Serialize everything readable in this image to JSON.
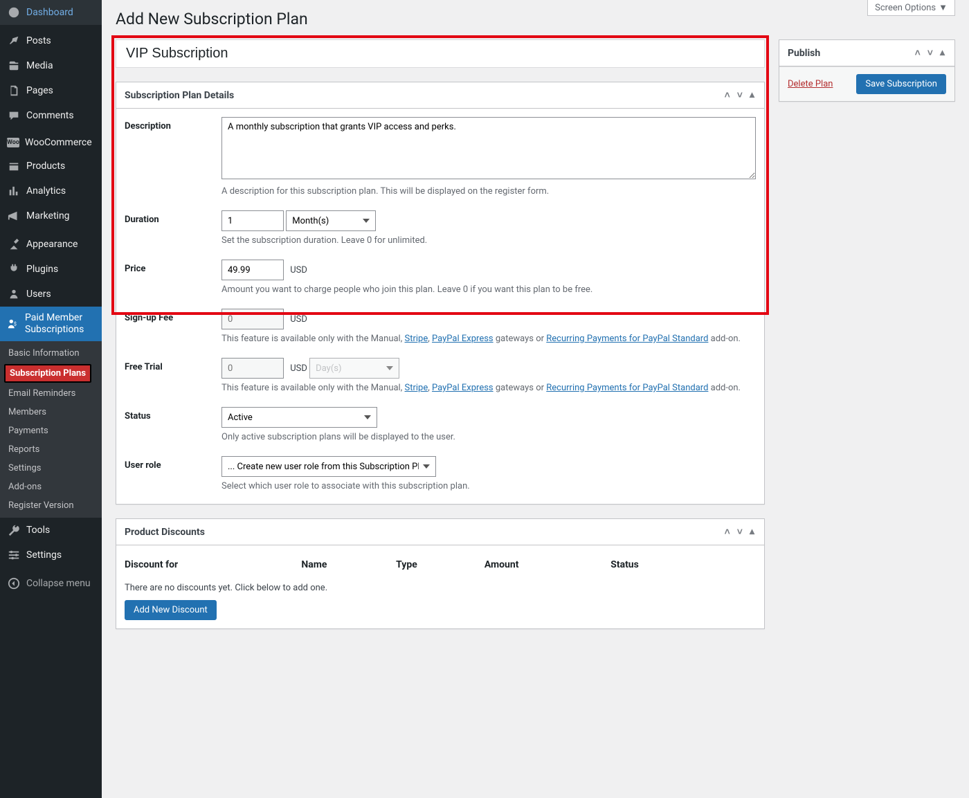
{
  "screen_options_label": "Screen Options",
  "page_title": "Add New Subscription Plan",
  "sidebar": {
    "items": [
      {
        "icon": "dashboard",
        "label": "Dashboard"
      },
      {
        "icon": "pin",
        "label": "Posts"
      },
      {
        "icon": "media",
        "label": "Media"
      },
      {
        "icon": "page",
        "label": "Pages"
      },
      {
        "icon": "comment",
        "label": "Comments"
      },
      {
        "icon": "woo",
        "label": "WooCommerce"
      },
      {
        "icon": "product",
        "label": "Products"
      },
      {
        "icon": "analytics",
        "label": "Analytics"
      },
      {
        "icon": "marketing",
        "label": "Marketing"
      },
      {
        "icon": "appearance",
        "label": "Appearance"
      },
      {
        "icon": "plugin",
        "label": "Plugins"
      },
      {
        "icon": "users",
        "label": "Users"
      },
      {
        "icon": "pms",
        "label": "Paid Member Subscriptions"
      },
      {
        "icon": "tools",
        "label": "Tools"
      },
      {
        "icon": "settings",
        "label": "Settings"
      },
      {
        "icon": "collapse",
        "label": "Collapse menu"
      }
    ],
    "submenu": [
      "Basic Information",
      "Subscription Plans",
      "Email Reminders",
      "Members",
      "Payments",
      "Reports",
      "Settings",
      "Add-ons",
      "Register Version"
    ]
  },
  "title_input": "VIP Subscription",
  "details": {
    "box_title": "Subscription Plan Details",
    "description_label": "Description",
    "description_value": "A monthly subscription that grants VIP access and perks.",
    "description_hint": "A description for this subscription plan. This will be displayed on the register form.",
    "duration_label": "Duration",
    "duration_value": "1",
    "duration_unit": "Month(s)",
    "duration_hint": "Set the subscription duration. Leave 0 for unlimited.",
    "price_label": "Price",
    "price_value": "49.99",
    "price_currency": "USD",
    "price_hint": "Amount you want to charge people who join this plan. Leave 0 if you want this plan to be free.",
    "signup_label": "Sign-up Fee",
    "signup_placeholder": "0",
    "signup_currency": "USD",
    "signup_hint_pre": "This feature is available only with the Manual,",
    "stripe_link": "Stripe",
    "paypal_express_link": "PayPal Express",
    "gateways_or": "gateways or",
    "recurring_link": "Recurring Payments for PayPal Standard",
    "addon_suffix": "add-on.",
    "trial_label": "Free Trial",
    "trial_placeholder": "0",
    "trial_currency": "USD",
    "trial_unit": "Day(s)",
    "status_label": "Status",
    "status_value": "Active",
    "status_hint": "Only active subscription plans will be displayed to the user.",
    "role_label": "User role",
    "role_value": "... Create new user role from this Subscription Plan",
    "role_hint": "Select which user role to associate with this subscription plan."
  },
  "discounts": {
    "box_title": "Product Discounts",
    "cols": [
      "Discount for",
      "Name",
      "Type",
      "Amount",
      "Status"
    ],
    "empty": "There are no discounts yet. Click below to add one.",
    "add_btn": "Add New Discount"
  },
  "publish": {
    "box_title": "Publish",
    "delete": "Delete Plan",
    "save": "Save Subscription"
  }
}
